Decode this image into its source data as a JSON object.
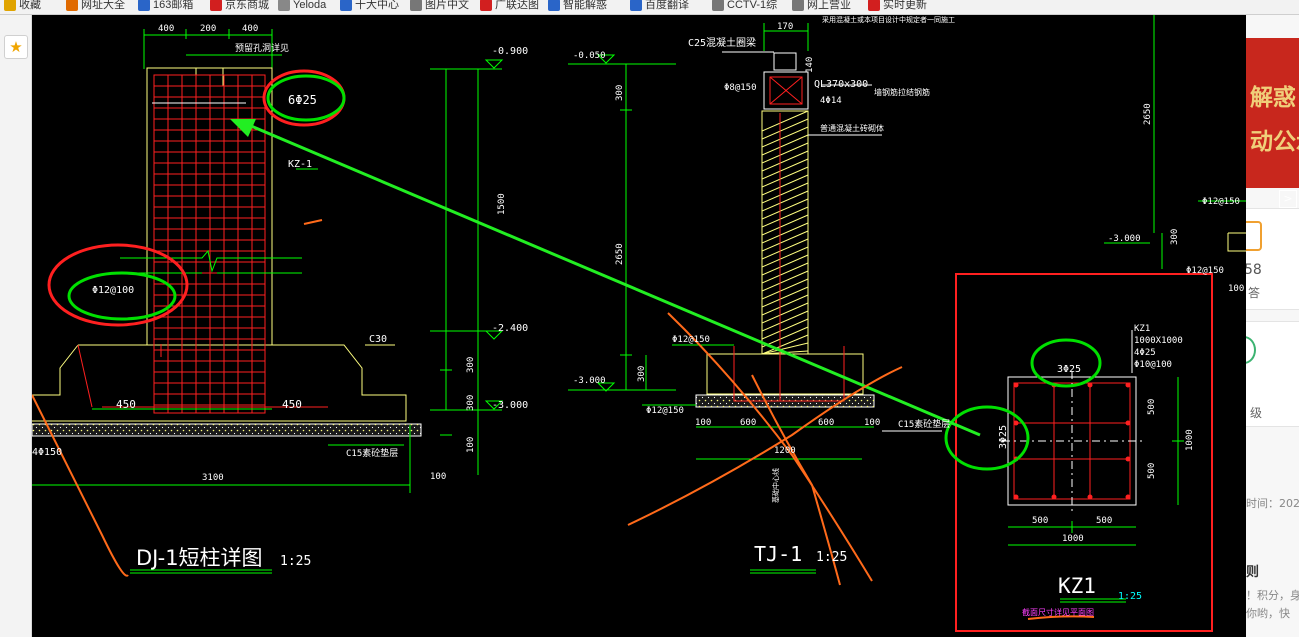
{
  "bookmarks": [
    {
      "label": "收藏",
      "color": "#e0a400"
    },
    {
      "label": "网址大全",
      "color": "#e06a00"
    },
    {
      "label": "163邮箱",
      "color": "#2a65c8"
    },
    {
      "label": "京东商城",
      "color": "#d21f1f"
    },
    {
      "label": "Yeloda",
      "color": "#888888"
    },
    {
      "label": "十大中心",
      "color": "#2a65c8"
    },
    {
      "label": "图片中文",
      "color": "#777777"
    },
    {
      "label": "广联达图",
      "color": "#d21f1f"
    },
    {
      "label": "智能解惑",
      "color": "#2a65c8"
    },
    {
      "label": "百度翻译",
      "color": "#2a65c8"
    },
    {
      "label": "CCTV-1综",
      "color": "#777777"
    },
    {
      "label": "网上营业",
      "color": "#777777"
    },
    {
      "label": "实时更新",
      "color": "#d21f1f"
    }
  ],
  "sidebar": {
    "star_icon": "star-icon"
  },
  "right_panel": {
    "banner_line1": "解惑",
    "banner_line2": "动公示",
    "banner_arrow": ">",
    "stat_number": "58",
    "stat_label": "答",
    "level_label": "级",
    "time_label": "时间：202",
    "title_fragment": "则",
    "text_line1": "！积分，身",
    "text_line2": "你哟，快"
  },
  "drawing": {
    "colors": {
      "bg": "#000000",
      "green": "#00ff00",
      "red": "#ff2020",
      "yellow": "#ffff80",
      "white": "#ffffff",
      "orange": "#ff6a1a",
      "cyan": "#00ffff",
      "magenta": "#ff40ff"
    },
    "dj1": {
      "title": "DJ-1短柱详图",
      "scale": "1:25",
      "dims_top": [
        "400",
        "200",
        "400"
      ],
      "note_top": "预留孔洞详见",
      "rebar_top": "6Φ25",
      "column_label": "KZ-1",
      "stirrup": "Φ12@100",
      "concrete": "C30",
      "bottom_left": "450",
      "bottom_right": "450",
      "width_total": "3100",
      "cushion_label": "C15素砼垫层",
      "bar_left": "4Φ150",
      "cushion_thickness": "100",
      "elev_top": "-0.900",
      "elev_mid": "-2.400",
      "elev_bottom": "-3.000",
      "height_main": "1500",
      "height_300a": "300",
      "height_300b": "300",
      "height_100": "100"
    },
    "tj1": {
      "title": "TJ-1",
      "scale": "1:25",
      "elev_top": "-0.050",
      "elev_bottom": "-3.000",
      "beam_concrete": "C25混凝土圈梁",
      "width_top": "170",
      "beam_note": "采用混凝土或本项目设计中规定者一同施工",
      "beam_label": "QL370x300",
      "beam_bars": "4Φ14",
      "beam_stirrup": "Φ8@150",
      "beam_height": "140",
      "wall_note": "墙钢筋拉结钢筋",
      "wall_fill": "普通混凝土砖砌体",
      "height_300": "300",
      "height_2650": "2650",
      "bar_top": "Φ12@150",
      "bar_bottom": "Φ12@150",
      "base_height": "300",
      "dim_100a": "100",
      "dim_600a": "600",
      "dim_600b": "600",
      "dim_100b": "100",
      "dim_total": "1200",
      "cushion_label": "C15素砼垫层",
      "diag_note": "基础中心线"
    },
    "right_strip": {
      "height_2650": "2650",
      "bar1": "Φ12@150",
      "elev": "-3.000",
      "height_300": "300",
      "bar2": "Φ12@150",
      "dim_100": "100"
    },
    "kz1": {
      "title": "KZ1",
      "scale": "1:25",
      "spec_name": "KZ1",
      "spec_size": "1000X1000",
      "spec_bars": "4Φ25",
      "spec_stirrup": "Φ10@100",
      "rebar_top": "3Φ25",
      "rebar_side": "3Φ25",
      "dim_500_top": "500",
      "dim_1000_right": "1000",
      "dim_500_bottom": "500",
      "dim_500a": "500",
      "dim_500b": "500",
      "dim_1000": "1000",
      "caption_note": "截面尺寸详见平面图"
    }
  }
}
